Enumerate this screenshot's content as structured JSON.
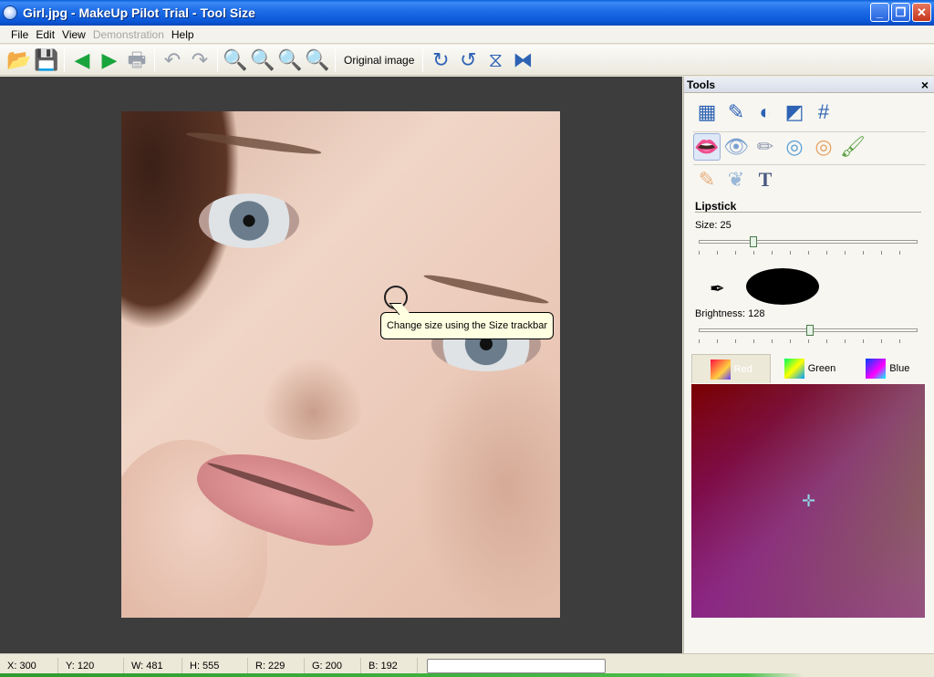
{
  "title": "Girl.jpg - MakeUp Pilot Trial - Tool Size",
  "menu": {
    "file": "File",
    "edit": "Edit",
    "view": "View",
    "demonstration": "Demonstration",
    "help": "Help"
  },
  "toolbar": {
    "original_image": "Original image"
  },
  "canvas": {
    "tooltip": "Change size using the Size trackbar"
  },
  "panel": {
    "title": "Tools",
    "section": "Lipstick",
    "size_label": "Size: 25",
    "size_value": 25,
    "brightness_label": "Brightness: 128",
    "brightness_value": 128,
    "tabs": {
      "red": "Red",
      "green": "Green",
      "blue": "Blue"
    }
  },
  "status": {
    "x": "X: 300",
    "y": "Y: 120",
    "w": "W: 481",
    "h": "H: 555",
    "r": "R: 229",
    "g": "G: 200",
    "b": "B: 192"
  }
}
